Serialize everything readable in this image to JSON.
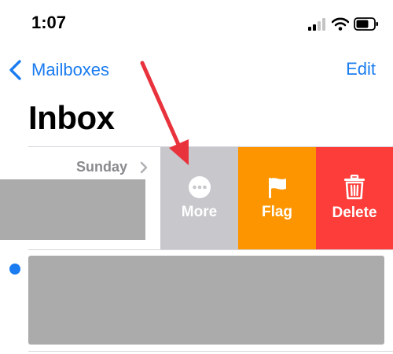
{
  "status_bar": {
    "time": "1:07",
    "icons": [
      "signal-icon",
      "wifi-icon",
      "battery-icon"
    ]
  },
  "nav": {
    "back_label": "Mailboxes",
    "edit_label": "Edit"
  },
  "page": {
    "title": "Inbox"
  },
  "messages": [
    {
      "date": "Sunday",
      "swiped": true,
      "unread": false
    },
    {
      "date": "",
      "swiped": false,
      "unread": true
    }
  ],
  "swipe_actions": [
    {
      "label": "More",
      "icon": "more-icon",
      "color": "#c7c7cc"
    },
    {
      "label": "Flag",
      "icon": "flag-icon",
      "color": "#fd9500"
    },
    {
      "label": "Delete",
      "icon": "trash-icon",
      "color": "#fc3d39"
    }
  ],
  "colors": {
    "accent": "#1a7cf0",
    "annotation_arrow": "#e8323c"
  }
}
